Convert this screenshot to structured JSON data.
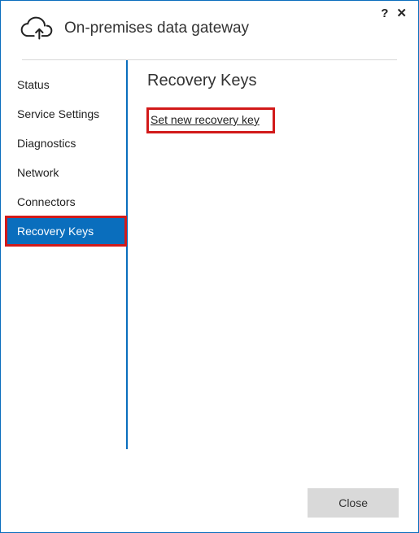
{
  "window": {
    "title": "On-premises data gateway",
    "help_icon": "?",
    "close_icon": "✕"
  },
  "sidebar": {
    "items": [
      {
        "label": "Status",
        "active": false
      },
      {
        "label": "Service Settings",
        "active": false
      },
      {
        "label": "Diagnostics",
        "active": false
      },
      {
        "label": "Network",
        "active": false
      },
      {
        "label": "Connectors",
        "active": false
      },
      {
        "label": "Recovery Keys",
        "active": true
      }
    ]
  },
  "content": {
    "heading": "Recovery Keys",
    "link_label": "Set new recovery key"
  },
  "footer": {
    "close_label": "Close"
  }
}
